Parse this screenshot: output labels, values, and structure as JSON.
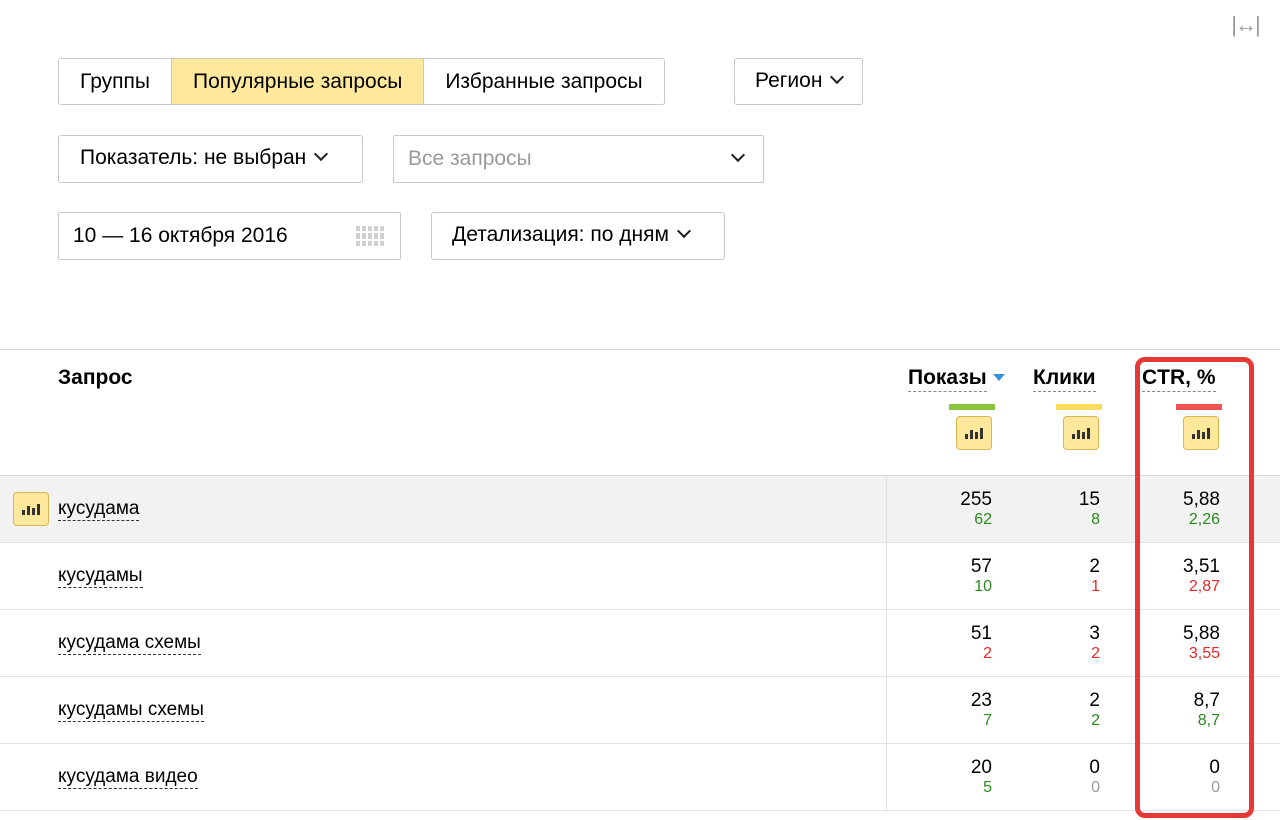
{
  "tabs": [
    {
      "label": "Группы",
      "active": false
    },
    {
      "label": "Популярные запросы",
      "active": true
    },
    {
      "label": "Избранные запросы",
      "active": false
    }
  ],
  "region_label": "Регион",
  "metric_label": "Показатель: не выбран",
  "query_filter_value": "Все запросы",
  "date_range": "10 — 16 октября 2016",
  "detail_label": "Детализация: по дням",
  "table": {
    "headers": {
      "query": "Запрос",
      "shows": "Показы",
      "clicks": "Клики",
      "ctr": "CTR, %"
    },
    "colors": {
      "shows": "#8cc63f",
      "clicks": "#fddc5c",
      "ctr": "#ef5350",
      "accent_highlight": "#fde89b",
      "frame": "#e53935"
    },
    "rows": [
      {
        "query": "кусудама",
        "shows": "255",
        "shows_delta": "62",
        "clicks": "15",
        "clicks_delta": "8",
        "ctr": "5,88",
        "ctr_delta": "2,26"
      },
      {
        "query": "кусудамы",
        "shows": "57",
        "shows_delta": "10",
        "clicks": "2",
        "clicks_delta": "1",
        "ctr": "3,51",
        "ctr_delta": "2,87"
      },
      {
        "query": "кусудама схемы",
        "shows": "51",
        "shows_delta": "2",
        "clicks": "3",
        "clicks_delta": "2",
        "ctr": "5,88",
        "ctr_delta": "3,55"
      },
      {
        "query": "кусудамы схемы",
        "shows": "23",
        "shows_delta": "7",
        "clicks": "2",
        "clicks_delta": "2",
        "ctr": "8,7",
        "ctr_delta": "8,7"
      },
      {
        "query": "кусудама видео",
        "shows": "20",
        "shows_delta": "5",
        "clicks": "0",
        "clicks_delta": "0",
        "ctr": "0",
        "ctr_delta": "0"
      }
    ]
  },
  "icons": {
    "expand": "expand-horizontal-icon",
    "calendar": "calendar-icon",
    "chart": "bar-chart-icon",
    "dropdown": "chevron-down-icon",
    "sort": "sort-desc-icon"
  }
}
